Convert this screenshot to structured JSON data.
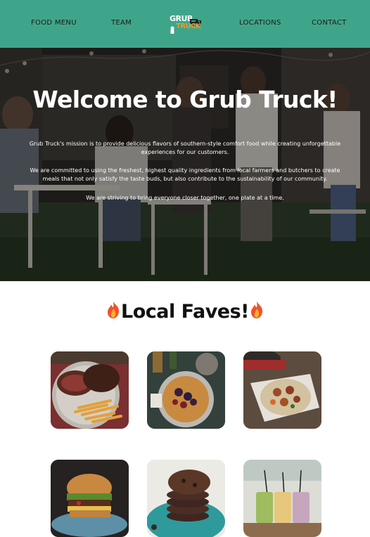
{
  "nav": {
    "items": [
      "FOOD MENU",
      "TEAM",
      "LOCATIONS",
      "CONTACT"
    ],
    "logo_line1": "GRUB",
    "logo_line2": "TRUCK",
    "logo_icons": [
      "food-truck-icon",
      "chef-icon"
    ]
  },
  "hero": {
    "title": "Welcome to Grub Truck!",
    "paragraphs": [
      "Grub Truck's mission is to provide delicious flavors of southern-style comfort food while creating unforgettable experiences for our customers.",
      "We are committed to using the freshest, highest quality ingredients from local farmers and butchers to create meals that not only satisfy the taste buds, but also contribute to the sustainability of our community.",
      "We are striving to bring everyone closer together, one plate at a time."
    ]
  },
  "faves": {
    "title": "Local Faves!",
    "title_icon": "fire-icon",
    "items": [
      {
        "icon": "steak-fries-photo"
      },
      {
        "icon": "waffles-berries-photo"
      },
      {
        "icon": "sausage-skillet-photo"
      },
      {
        "icon": "burger-photo"
      },
      {
        "icon": "cookies-photo"
      },
      {
        "icon": "smoothies-photo"
      }
    ]
  },
  "colors": {
    "nav_bg": "#3fa58a",
    "logo_accent": "#f39a1d",
    "hero_text": "#ffffff"
  }
}
